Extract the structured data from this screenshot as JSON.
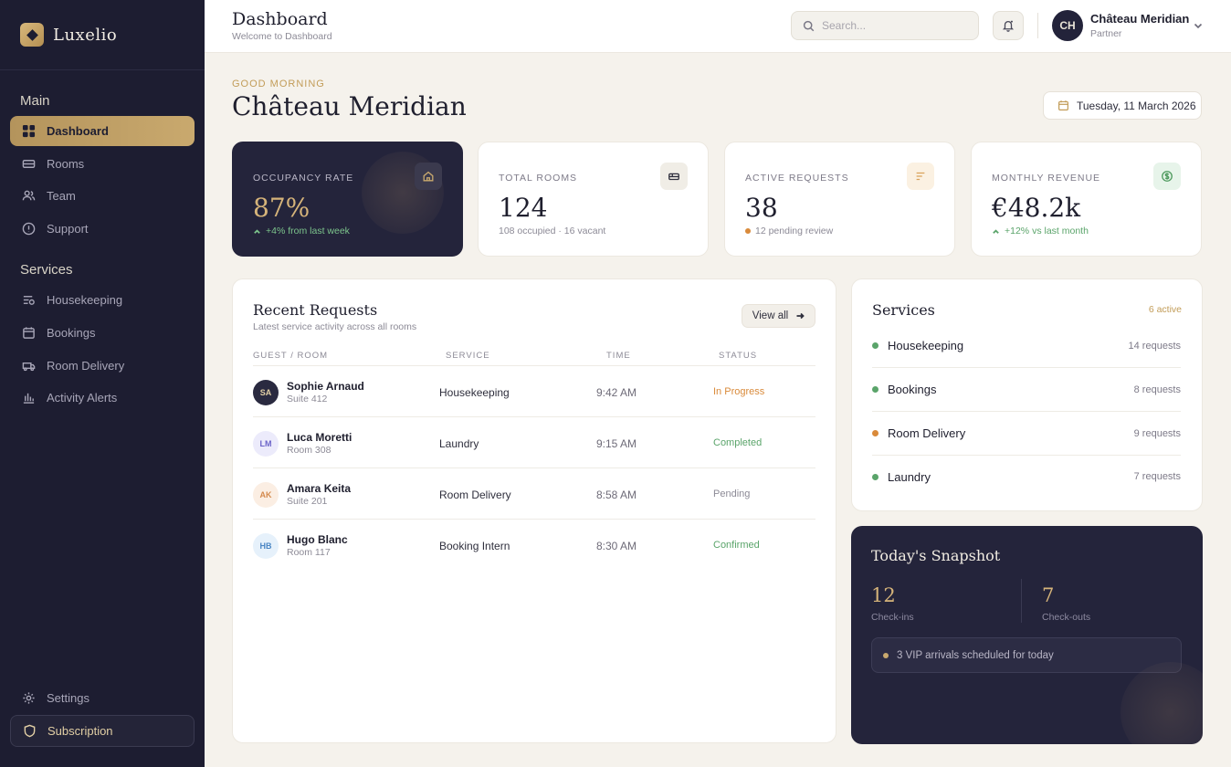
{
  "brand": {
    "name": "Luxelio"
  },
  "sidebar": {
    "section_main": "Main",
    "main_items": [
      {
        "label": "Dashboard",
        "icon": "grid-icon"
      },
      {
        "label": "Rooms",
        "icon": "bed-icon"
      },
      {
        "label": "Team",
        "icon": "users-icon"
      },
      {
        "label": "Support",
        "icon": "help-icon"
      }
    ],
    "section_services": "Services",
    "service_items": [
      {
        "label": "Housekeeping",
        "icon": "broom-icon"
      },
      {
        "label": "Bookings",
        "icon": "calendar-icon"
      },
      {
        "label": "Room Delivery",
        "icon": "cart-icon"
      },
      {
        "label": "Activity Alerts",
        "icon": "bars-icon"
      }
    ],
    "settings": "Settings",
    "subscription": "Subscription"
  },
  "header": {
    "title": "Dashboard",
    "subtitle": "Welcome to Dashboard",
    "search_placeholder": "Search...",
    "user_initials": "CH",
    "user_name": "Château Meridian",
    "user_role": "Partner"
  },
  "greeting": {
    "label": "GOOD MORNING",
    "hotel": "Château Meridian",
    "date": "Tuesday, 11 March 2026"
  },
  "stats": [
    {
      "label": "OCCUPANCY RATE",
      "value": "87%",
      "note": "+4% from last week",
      "icon": "home-icon"
    },
    {
      "label": "TOTAL ROOMS",
      "value": "124",
      "note": "108 occupied · 16 vacant",
      "icon": "bed-icon"
    },
    {
      "label": "ACTIVE REQUESTS",
      "value": "38",
      "note": "12 pending review",
      "icon": "list-icon"
    },
    {
      "label": "MONTHLY REVENUE",
      "value": "€48.2k",
      "note": "+12% vs last month",
      "icon": "dollar-icon"
    }
  ],
  "requests": {
    "title": "Recent Requests",
    "subtitle": "Latest service activity across all rooms",
    "view_all": "View all",
    "columns": [
      "GUEST / ROOM",
      "SERVICE",
      "TIME",
      "STATUS"
    ],
    "rows": [
      {
        "initials": "SA",
        "name": "Sophie Arnaud",
        "room": "Suite 412",
        "service": "Housekeeping",
        "time": "9:42 AM",
        "status": "In Progress"
      },
      {
        "initials": "LM",
        "name": "Luca Moretti",
        "room": "Room 308",
        "service": "Laundry",
        "time": "9:15 AM",
        "status": "Completed"
      },
      {
        "initials": "AK",
        "name": "Amara Keita",
        "room": "Suite 201",
        "service": "Room Delivery",
        "time": "8:58 AM",
        "status": "Pending"
      },
      {
        "initials": "HB",
        "name": "Hugo Blanc",
        "room": "Room 117",
        "service": "Booking Intern",
        "time": "8:30 AM",
        "status": "Confirmed"
      }
    ]
  },
  "services": {
    "title": "Services",
    "active": "6 active",
    "items": [
      {
        "name": "Housekeeping",
        "count": "14 requests"
      },
      {
        "name": "Bookings",
        "count": "8 requests"
      },
      {
        "name": "Room Delivery",
        "count": "9 requests"
      },
      {
        "name": "Laundry",
        "count": "7 requests"
      }
    ]
  },
  "snapshot": {
    "title": "Today's Snapshot",
    "checkins": "12",
    "checkins_label": "Check-ins",
    "checkouts": "7",
    "checkouts_label": "Check-outs",
    "vip": "3 VIP arrivals scheduled for today"
  },
  "colors": {
    "accent": "#c9a96e",
    "navy": "#1d1d31",
    "green": "#5aa46a",
    "orange": "#d98a3a"
  }
}
